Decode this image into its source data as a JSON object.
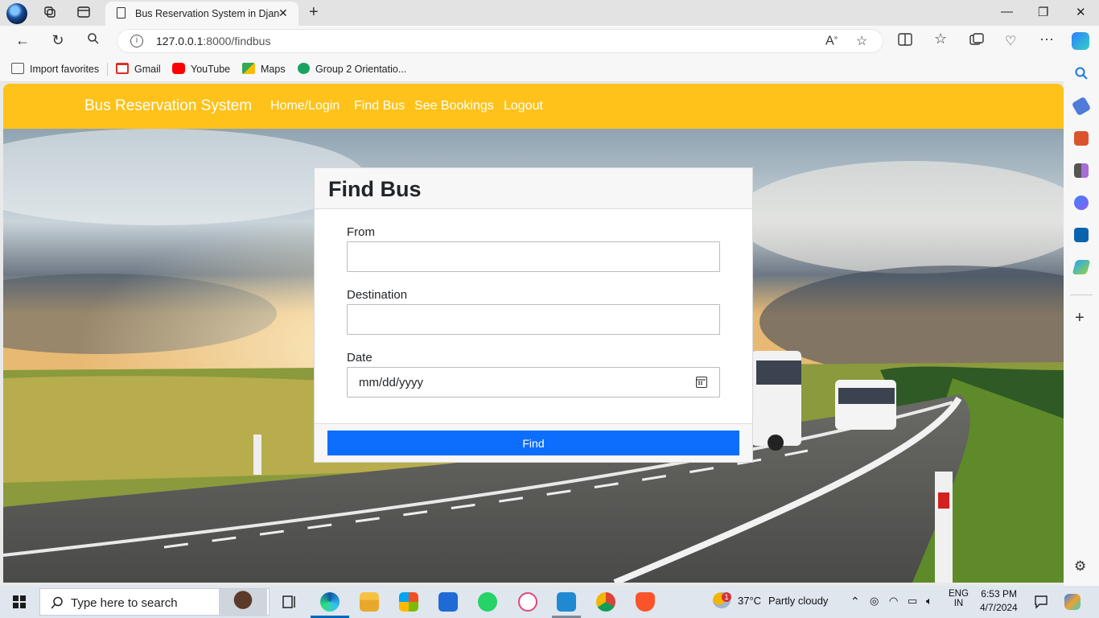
{
  "browser": {
    "tab_title": "Bus Reservation System in Django",
    "url_host": "127.0.0.1",
    "url_path": ":8000/findbus",
    "favorites": [
      {
        "label": "Import favorites",
        "color": "#555555"
      },
      {
        "label": "Gmail",
        "color": "#d93025"
      },
      {
        "label": "YouTube",
        "color": "#ff0000"
      },
      {
        "label": "Maps",
        "color": "#34a853"
      },
      {
        "label": "Group 2 Orientatio...",
        "color": "#1aa260"
      }
    ]
  },
  "nav": {
    "brand": "Bus Reservation System",
    "links": [
      "Home/Login",
      "Find Bus",
      "See Bookings",
      "Logout"
    ],
    "color": "#ffc21a"
  },
  "form": {
    "title": "Find Bus",
    "from_label": "From",
    "from_value": "",
    "destination_label": "Destination",
    "destination_value": "",
    "date_label": "Date",
    "date_placeholder": "mm/dd/yyyy",
    "submit_label": "Find",
    "submit_color": "#0d6efd"
  },
  "taskbar": {
    "search_placeholder": "Type here to search",
    "weather_temp": "37°C",
    "weather_text": "Partly cloudy",
    "weather_badge": "1",
    "lang_top": "ENG",
    "lang_bottom": "IN",
    "time": "6:53 PM",
    "date": "4/7/2024"
  }
}
